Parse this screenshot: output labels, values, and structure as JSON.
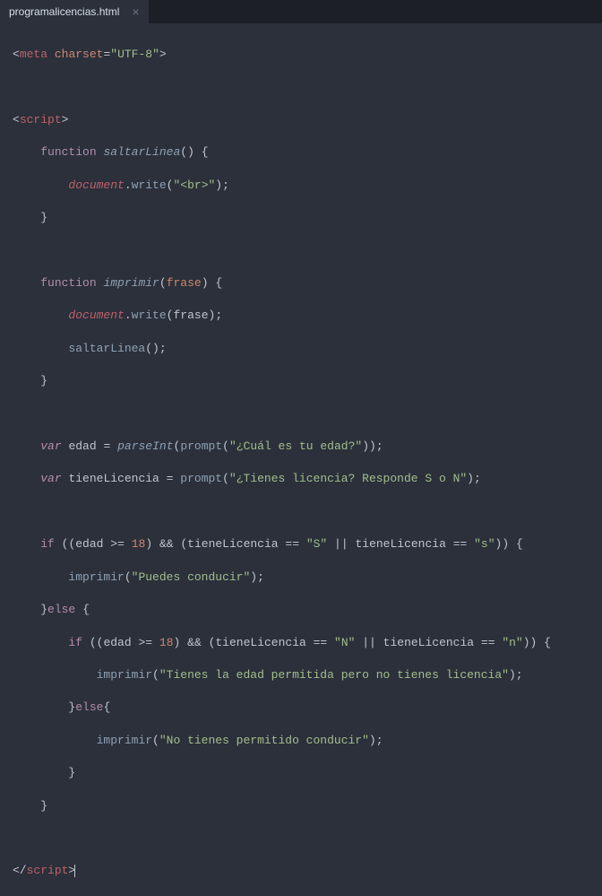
{
  "tab": {
    "filename": "programalicencias.html",
    "close": "×"
  },
  "code": {
    "l1": {
      "p1": "<",
      "p2": "meta",
      "p3": " ",
      "p4": "charset",
      "p5": "=",
      "p6": "\"UTF-8\"",
      "p7": ">"
    },
    "l3": {
      "p1": "<",
      "p2": "script",
      "p3": ">"
    },
    "l4": {
      "indent": "    ",
      "kw": "function",
      "sp": " ",
      "name": "saltarLinea",
      "open": "()",
      "sp2": " ",
      "brace": "{"
    },
    "l5": {
      "indent": "        ",
      "obj": "document",
      "dot": ".",
      "method": "write",
      "open": "(",
      "str": "\"<br>\"",
      "close": ")",
      "semi": ";"
    },
    "l6": {
      "indent": "    ",
      "brace": "}"
    },
    "l8": {
      "indent": "    ",
      "kw": "function",
      "sp": " ",
      "name": "imprimir",
      "open": "(",
      "param": "frase",
      "close": ")",
      "sp2": " ",
      "brace": "{"
    },
    "l9": {
      "indent": "        ",
      "obj": "document",
      "dot": ".",
      "method": "write",
      "open": "(",
      "arg": "frase",
      "close": ")",
      "semi": ";"
    },
    "l10": {
      "indent": "        ",
      "call": "saltarLinea",
      "paren": "()",
      "semi": ";"
    },
    "l11": {
      "indent": "    ",
      "brace": "}"
    },
    "l13": {
      "indent": "    ",
      "kw": "var",
      "sp": " ",
      "name": "edad",
      "sp2": " ",
      "eq": "=",
      "sp3": " ",
      "fn": "parseInt",
      "open": "(",
      "fn2": "prompt",
      "open2": "(",
      "str": "\"¿Cuál es tu edad?\"",
      "close2": ")",
      "close": ")",
      "semi": ";"
    },
    "l14": {
      "indent": "    ",
      "kw": "var",
      "sp": " ",
      "name": "tieneLicencia",
      "sp2": " ",
      "eq": "=",
      "sp3": " ",
      "fn": "prompt",
      "open": "(",
      "str": "\"¿Tienes licencia? Responde S o N\"",
      "close": ")",
      "semi": ";"
    },
    "l16": {
      "indent": "    ",
      "if": "if",
      "sp": " ",
      "op": "((",
      "v1": "edad",
      "sp2": " ",
      "cmp": ">=",
      "sp3": " ",
      "num": "18",
      "cp": ")",
      "sp4": " ",
      "and": "&&",
      "sp5": " ",
      "op2": "(",
      "v2": "tieneLicencia",
      "sp6": " ",
      "eq": "==",
      "sp7": " ",
      "s1": "\"S\"",
      "sp8": " ",
      "or": "||",
      "sp9": " ",
      "v3": "tieneLicencia",
      "sp10": " ",
      "eq2": "==",
      "sp11": " ",
      "s2": "\"s\"",
      "cp2": "))",
      "sp12": " ",
      "brace": "{"
    },
    "l17": {
      "indent": "        ",
      "call": "imprimir",
      "open": "(",
      "str": "\"Puedes conducir\"",
      "close": ")",
      "semi": ";"
    },
    "l18": {
      "indent": "    ",
      "cbrace": "}",
      "else": "else",
      "sp": " ",
      "obrace": "{"
    },
    "l19": {
      "indent": "        ",
      "if": "if",
      "sp": " ",
      "op": "((",
      "v1": "edad",
      "sp2": " ",
      "cmp": ">=",
      "sp3": " ",
      "num": "18",
      "cp": ")",
      "sp4": " ",
      "and": "&&",
      "sp5": " ",
      "op2": "(",
      "v2": "tieneLicencia",
      "sp6": " ",
      "eq": "==",
      "sp7": " ",
      "s1": "\"N\"",
      "sp8": " ",
      "or": "||",
      "sp9": " ",
      "v3": "tieneLicencia",
      "sp10": " ",
      "eq2": "==",
      "sp11": " ",
      "s2": "\"n\"",
      "cp2": "))",
      "sp12": " ",
      "brace": "{"
    },
    "l20": {
      "indent": "            ",
      "call": "imprimir",
      "open": "(",
      "str": "\"Tienes la edad permitida pero no tienes licencia\"",
      "close": ")",
      "semi": ";"
    },
    "l21": {
      "indent": "        ",
      "cbrace": "}",
      "else": "else",
      "obrace": "{"
    },
    "l22": {
      "indent": "            ",
      "call": "imprimir",
      "open": "(",
      "str": "\"No tienes permitido conducir\"",
      "close": ")",
      "semi": ";"
    },
    "l23": {
      "indent": "        ",
      "brace": "}"
    },
    "l24": {
      "indent": "    ",
      "brace": "}"
    },
    "l26": {
      "p1": "</",
      "p2": "script",
      "p3": ">"
    }
  }
}
